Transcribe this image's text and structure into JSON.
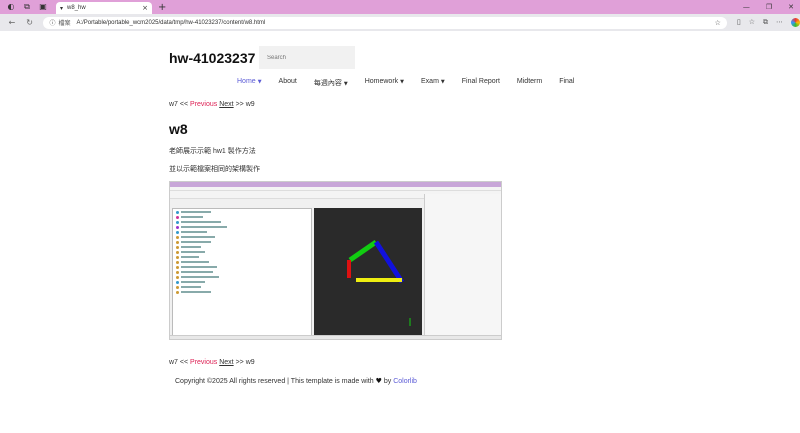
{
  "browser": {
    "tab_title": "w8_hw",
    "address_security": "檔案",
    "address_url": "A:/Portable/portable_wcm2025/data/tmp/hw-41023237/content/w8.html"
  },
  "site": {
    "title": "hw-41023237",
    "search_placeholder": "Search"
  },
  "menu": [
    {
      "label": "Home",
      "dropdown": true,
      "active": true
    },
    {
      "label": "About",
      "dropdown": false
    },
    {
      "label": "每週內容",
      "dropdown": true
    },
    {
      "label": "Homework",
      "dropdown": true
    },
    {
      "label": "Exam",
      "dropdown": true
    },
    {
      "label": "Final Report",
      "dropdown": false
    },
    {
      "label": "Midterm",
      "dropdown": false
    },
    {
      "label": "Final",
      "dropdown": false
    }
  ],
  "pager": {
    "prev_page": "w7",
    "prefix": " << ",
    "previous": "Previous",
    "next": "Next",
    "suffix": " >> ",
    "next_page": "w9"
  },
  "content": {
    "heading": "w8",
    "line1": "老師展示示範 hw1 製作方法",
    "line2": "並以示範檔案相同的架構製作"
  },
  "footer": {
    "text": "Copyright ©2025 All rights reserved | This template is made with",
    "by": " by ",
    "link": "Colorlib"
  }
}
